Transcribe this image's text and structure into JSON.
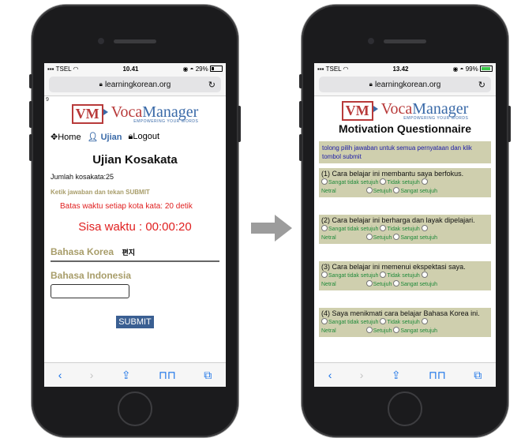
{
  "left_phone": {
    "status": {
      "carrier": "TSEL",
      "time": "10.41",
      "battery": "29%"
    },
    "url": "learningkorean.org",
    "corner_text": "9",
    "logo": {
      "mark": "VM",
      "name_part1": "Voca",
      "name_part2": "Manager",
      "tagline": "EMPOWERING YOUR WORDS"
    },
    "nav": {
      "home": "Home",
      "exam": "Ujian",
      "logout": "Logout"
    },
    "title": "Ujian Kosakata",
    "count_text": "Jumlah kosakata:25",
    "instruction": "Ketik jawaban dan tekan SUBMIT",
    "time_limit": "Batas waktu setiap kota kata: 20 detik",
    "remaining": "Sisa waktu : 00:00:20",
    "korean_label": "Bahasa Korea",
    "korean_word": "편지",
    "indonesian_label": "Bahasa Indonesia",
    "answer_value": "",
    "submit": "SUBMIT"
  },
  "right_phone": {
    "status": {
      "carrier": "TSEL",
      "time": "13.42",
      "battery": "99%"
    },
    "url": "learningkorean.org",
    "logo": {
      "mark": "VM",
      "name_part1": "Voca",
      "name_part2": "Manager",
      "tagline": "EMPOWERING YOUR WORDS"
    },
    "title": "Motivation Questionnaire",
    "notice": "tolong pilih jawaban untuk semua pernyataan dan klik tombol submit",
    "options": [
      "Sangat tidak setujuh",
      "Tidak setujuh",
      "Netral",
      "Setujuh",
      "Sangat setujuh"
    ],
    "questions": [
      "(1) Cara belajar ini membantu saya berfokus.",
      "(2) Cara belajar ini berharga dan layak dipelajari.",
      "(3) Cara belajar ini memenui ekspektasi saya.",
      "(4) Saya menikmati cara belajar Bahasa Korea ini."
    ]
  },
  "icons": [
    "wifi-icon",
    "lock-icon",
    "reload-icon",
    "back-icon",
    "forward-icon",
    "share-icon",
    "bookmarks-icon",
    "tabs-icon",
    "home-icon",
    "user-icon",
    "arrow-right-icon"
  ],
  "colors": {
    "accent_blue": "#3a6aa8",
    "brand_red": "#b83a3a",
    "timer_red": "#e02020",
    "olive": "#cfcfae",
    "option_green": "#1f8a3a"
  }
}
